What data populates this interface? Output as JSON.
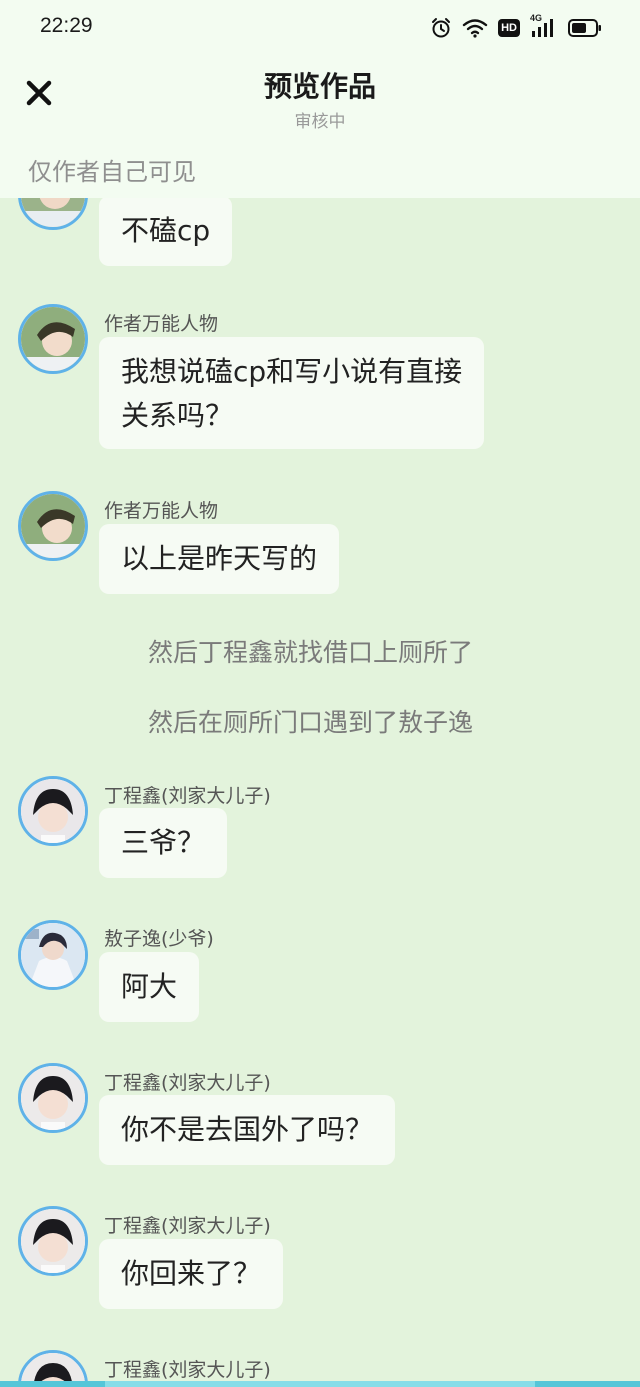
{
  "status_bar": {
    "time": "22:29",
    "hd": "HD",
    "network": "4G"
  },
  "header": {
    "title": "预览作品",
    "subtitle": "审核中",
    "visibility": "仅作者自己可见"
  },
  "messages": [
    {
      "bubble": "不磕cp"
    },
    {
      "name": "作者万能人物",
      "bubble_line1": "我想说磕cp和写小说有直接",
      "bubble_line2": "关系吗？"
    },
    {
      "name": "作者万能人物",
      "bubble": "以上是昨天写的"
    },
    {
      "narration": "然后丁程鑫就找借口上厕所了"
    },
    {
      "narration": "然后在厕所门口遇到了敖子逸"
    },
    {
      "name": "丁程鑫(刘家大儿子)",
      "bubble": "三爷？"
    },
    {
      "name": "敖子逸(少爷)",
      "bubble": "阿大"
    },
    {
      "name": "丁程鑫(刘家大儿子)",
      "bubble": "你不是去国外了吗？"
    },
    {
      "name": "丁程鑫(刘家大儿子)",
      "bubble": "你回来了？"
    },
    {
      "name": "丁程鑫(刘家大儿子)"
    }
  ],
  "colors": {
    "background": "#e3f3dc",
    "header": "#f3fcf1",
    "bubble": "#f6fbf4",
    "avatar_border": "#5fb2e8"
  },
  "icons": [
    "alarm-icon",
    "wifi-icon",
    "hd-icon",
    "signal-icon",
    "battery-icon",
    "close-icon"
  ]
}
